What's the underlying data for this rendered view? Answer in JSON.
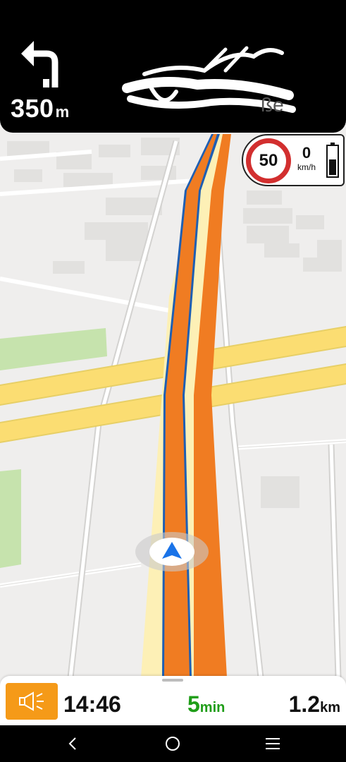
{
  "instruction": {
    "turn_icon": "turn-left-arrow-icon",
    "distance_value": "350",
    "distance_unit": "m",
    "street_name_obscured": true
  },
  "speed": {
    "limit": "50",
    "current": "0",
    "unit": "km/h",
    "battery_icon": "battery-icon"
  },
  "trip": {
    "voice_icon": "speaker-icon",
    "arrival_time": "14:46",
    "eta_value": "5",
    "eta_unit": "min",
    "remaining_value": "1.2",
    "remaining_unit": "km"
  },
  "system_nav": {
    "back_icon": "back-icon",
    "home_icon": "home-icon",
    "menu_icon": "menu-icon"
  },
  "colors": {
    "route": "#f07c22",
    "route_outline": "#1e5fb3",
    "highway": "#fbdd72",
    "speed_limit_ring": "#d22f2f",
    "eta_green": "#1f9d18",
    "voice_button": "#f59a18",
    "position_marker": "#1a73e8"
  }
}
